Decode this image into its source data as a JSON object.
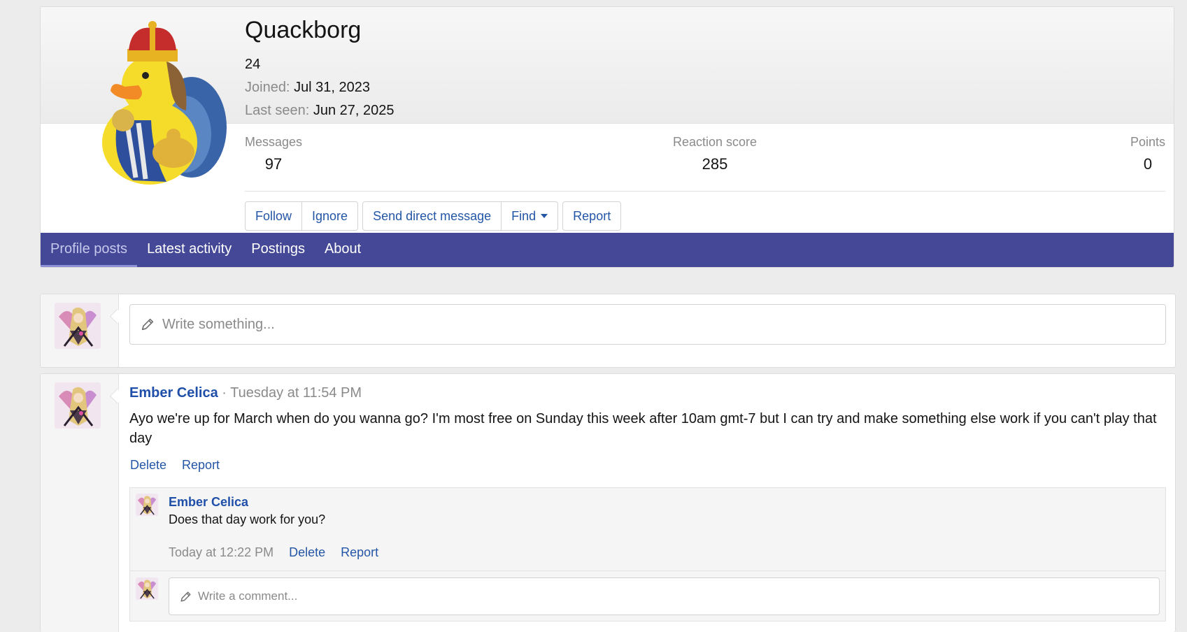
{
  "profile": {
    "username": "Quackborg",
    "user_title": "24",
    "joined_label": "Joined:",
    "joined_value": "Jul 31, 2023",
    "last_seen_label": "Last seen:",
    "last_seen_value": "Jun 27, 2025",
    "stats": {
      "messages_label": "Messages",
      "messages_value": "97",
      "reaction_label": "Reaction score",
      "reaction_value": "285",
      "points_label": "Points",
      "points_value": "0"
    },
    "buttons": {
      "follow": "Follow",
      "ignore": "Ignore",
      "send_dm": "Send direct message",
      "find": "Find",
      "report": "Report"
    }
  },
  "tabs": [
    {
      "label": "Profile posts",
      "active": true
    },
    {
      "label": "Latest activity",
      "active": false
    },
    {
      "label": "Postings",
      "active": false
    },
    {
      "label": "About",
      "active": false
    }
  ],
  "composer": {
    "placeholder": "Write something..."
  },
  "post": {
    "author": "Ember Celica",
    "separator": "·",
    "time": "Tuesday at 11:54 PM",
    "text": "Ayo we're up for March when do you wanna go? I'm most free on Sunday this week after 10am gmt-7 but I can try and make something else work if you can't play that day",
    "delete_label": "Delete",
    "report_label": "Report",
    "comment": {
      "author": "Ember Celica",
      "text": "Does that day work for you?",
      "time": "Today at 12:22 PM",
      "delete_label": "Delete",
      "report_label": "Report"
    },
    "comment_placeholder": "Write a comment..."
  },
  "colors": {
    "tab_bar": "#444896",
    "link": "#2456a6",
    "author": "#1f4fa8",
    "muted": "#8a8a8a"
  },
  "icons": {
    "edit": "pencil-icon",
    "dropdown": "caret-down-icon"
  }
}
